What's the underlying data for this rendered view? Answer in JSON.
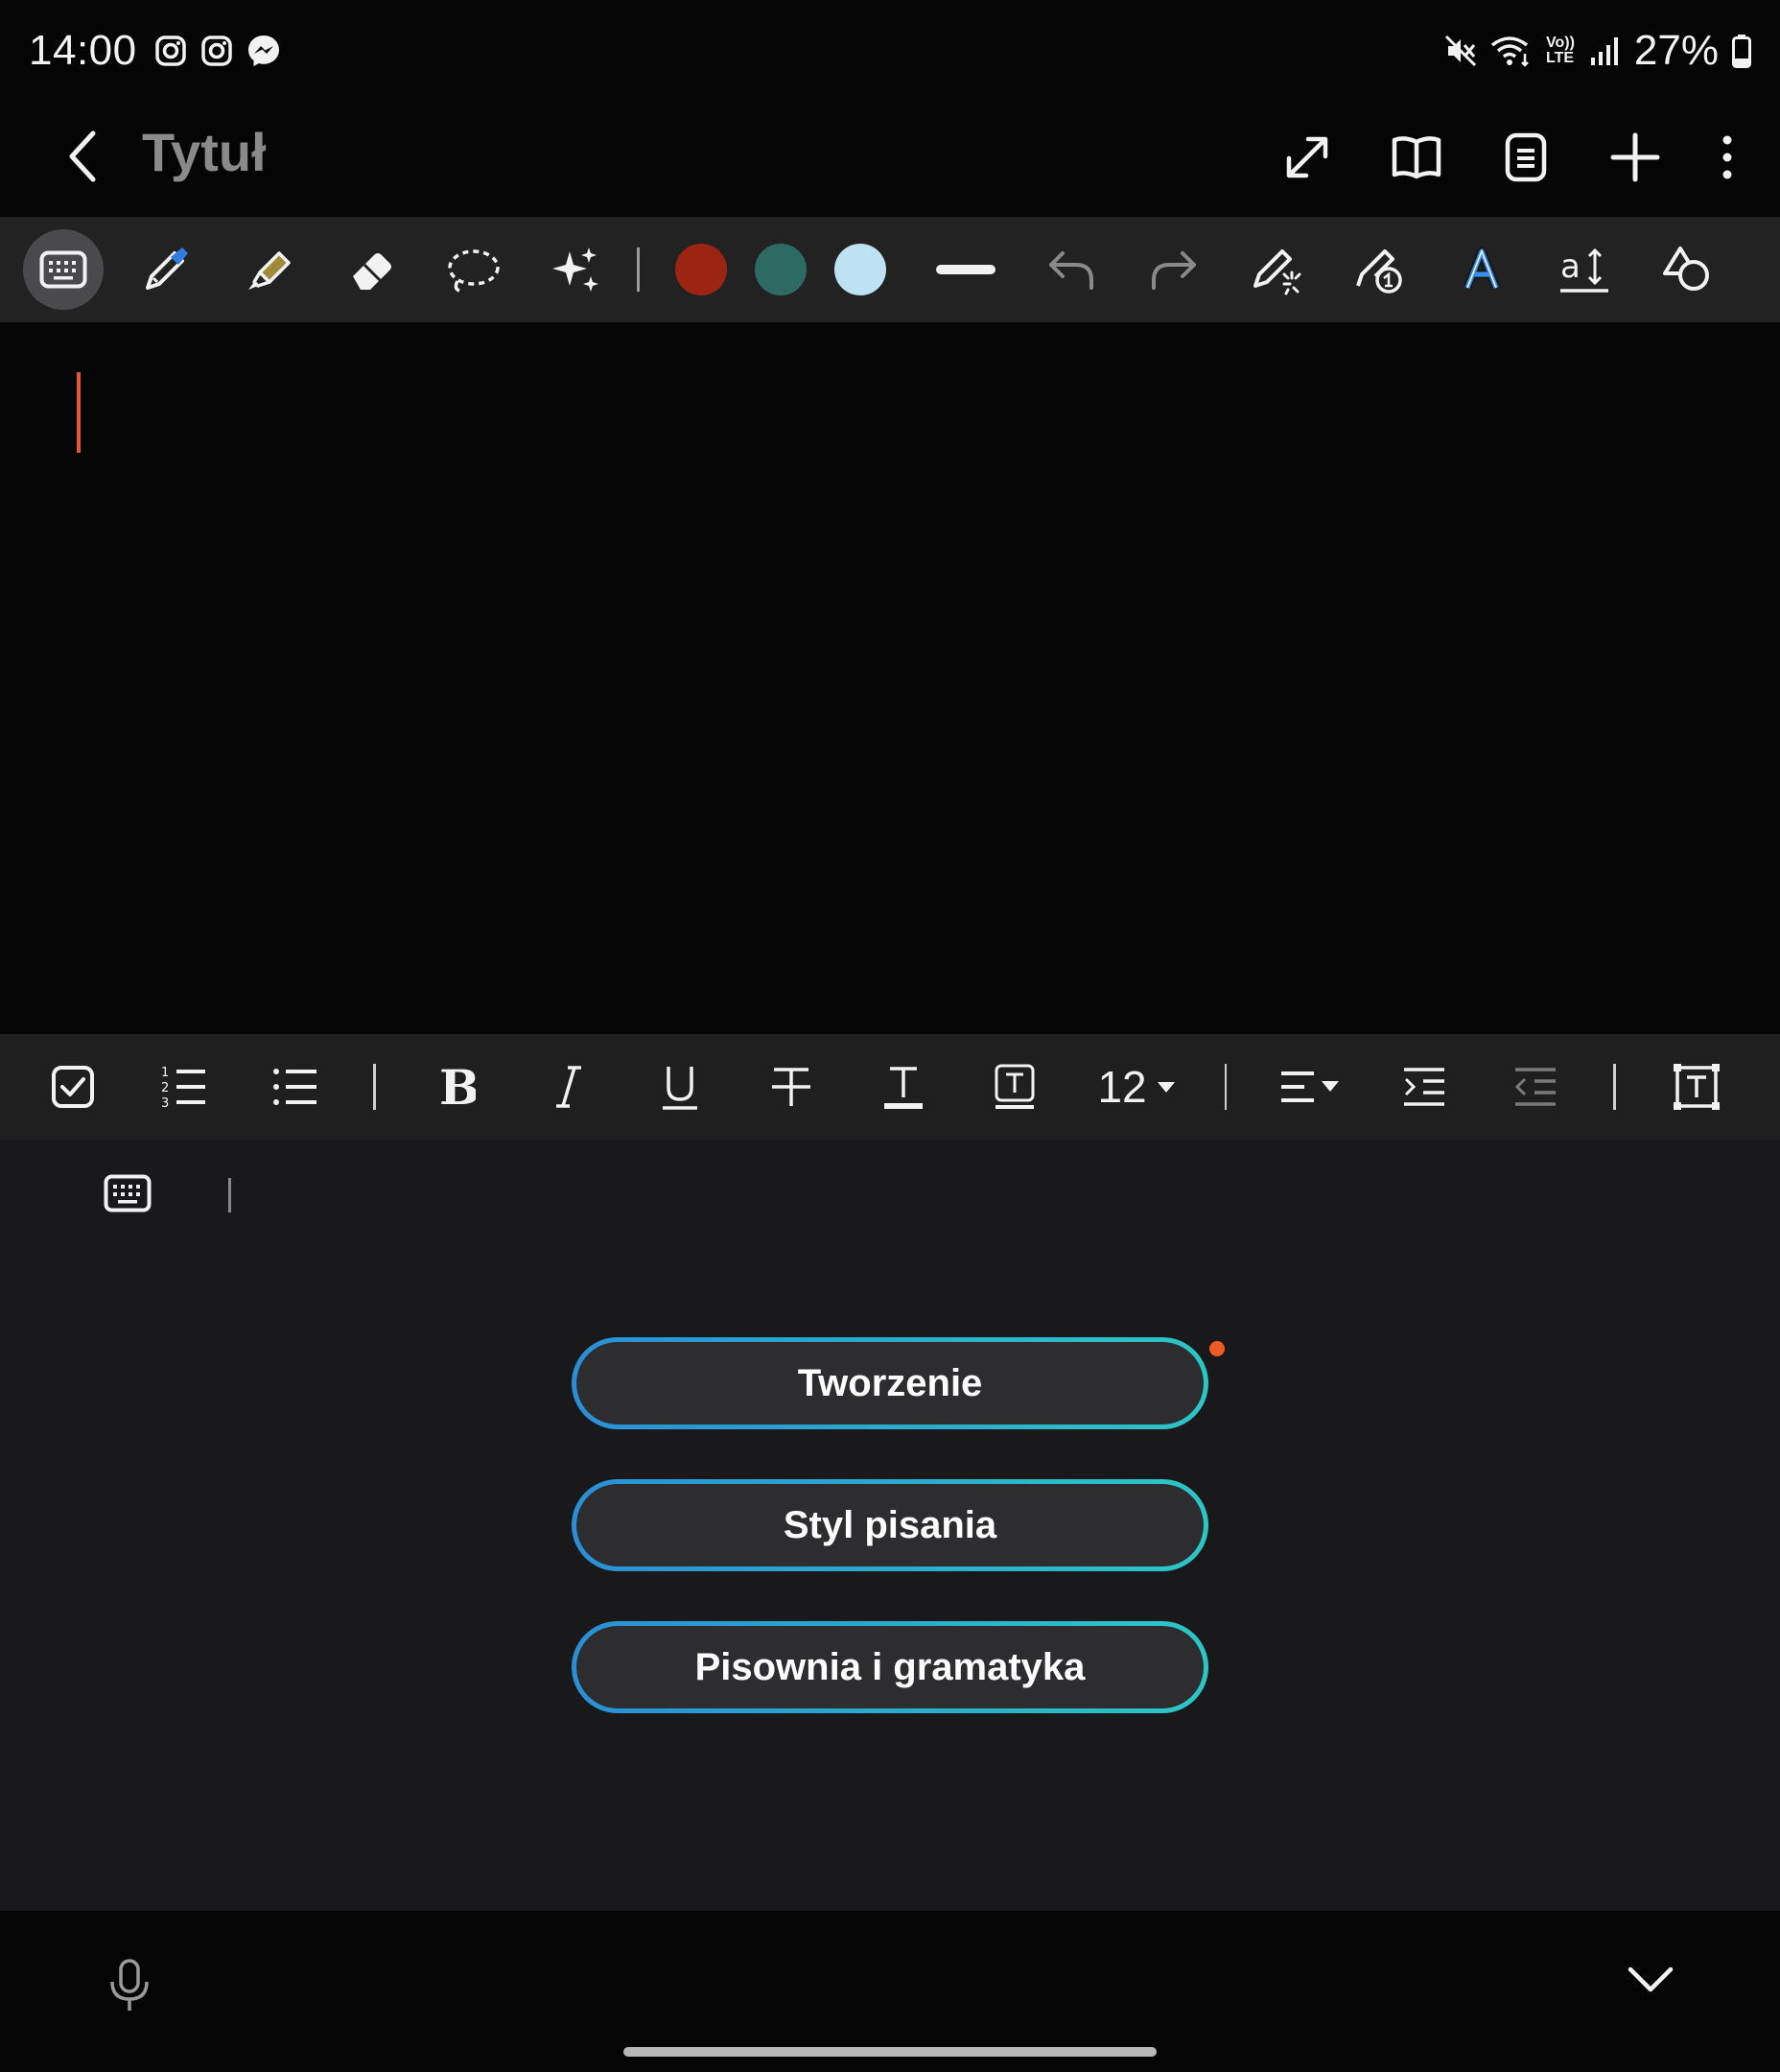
{
  "status_bar": {
    "time": "14:00",
    "notification_icons": [
      "instagram-icon",
      "instagram-icon",
      "messenger-icon"
    ],
    "battery": "27%",
    "indicators": [
      "mute-icon",
      "wifi-icon",
      "volte-icon",
      "signal-icon",
      "battery-icon"
    ],
    "volte_label_top": "Vo))",
    "volte_label_bottom": "LTE"
  },
  "app_bar": {
    "title": "Tytuł",
    "actions": [
      "expand-icon",
      "book-view-icon",
      "page-icon",
      "add-icon",
      "more-icon"
    ]
  },
  "pen_toolbar": {
    "tools": [
      "keyboard-mode",
      "pen",
      "highlighter",
      "eraser",
      "lasso",
      "ai-assist"
    ],
    "active_tool": "keyboard-mode",
    "colors": [
      "#9b2412",
      "#2d6a63",
      "#bfe2f2"
    ],
    "extras": [
      "stroke-width",
      "undo",
      "redo",
      "shape-pen",
      "writing-assist",
      "handwriting-to-text",
      "text-size",
      "shapes"
    ]
  },
  "format_bar": {
    "font_size": "12",
    "tools": [
      "checkbox",
      "numbered-list",
      "bulleted-list",
      "bold",
      "italic",
      "underline",
      "strikethrough",
      "text-color",
      "text-background",
      "font-size",
      "align",
      "indent",
      "outdent",
      "text-box"
    ]
  },
  "assist": {
    "options": [
      "Tworzenie",
      "Styl pisania",
      "Pisownia i gramatyka"
    ],
    "accent_start": "#2a8fd6",
    "accent_end": "#2cc6c6",
    "badge_color": "#ef5a24"
  },
  "bottom_bar": {
    "icons": [
      "microphone-icon",
      "chevron-down-icon"
    ]
  }
}
